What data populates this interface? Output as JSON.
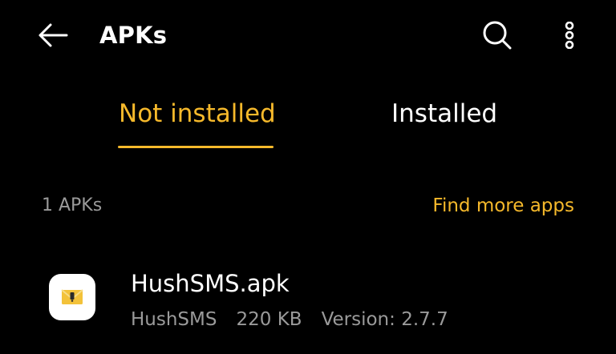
{
  "colors": {
    "background": "#000000",
    "accent": "#f6b92b",
    "text_primary": "#ffffff",
    "text_secondary": "#9a9a9a"
  },
  "topbar": {
    "back_icon": "arrow-left-icon",
    "title": "APKs",
    "search_icon": "search-icon",
    "more_icon": "more-vert-icon"
  },
  "tabs": [
    {
      "label": "Not installed",
      "selected": true
    },
    {
      "label": "Installed",
      "selected": false
    }
  ],
  "section": {
    "count": "1 APKs",
    "find_more": "Find more apps"
  },
  "apks": [
    {
      "icon": "hushsms-app-icon",
      "name": "HushSMS.apk",
      "app_label": "HushSMS",
      "size": "220 KB",
      "version": "Version: 2.7.7"
    }
  ]
}
